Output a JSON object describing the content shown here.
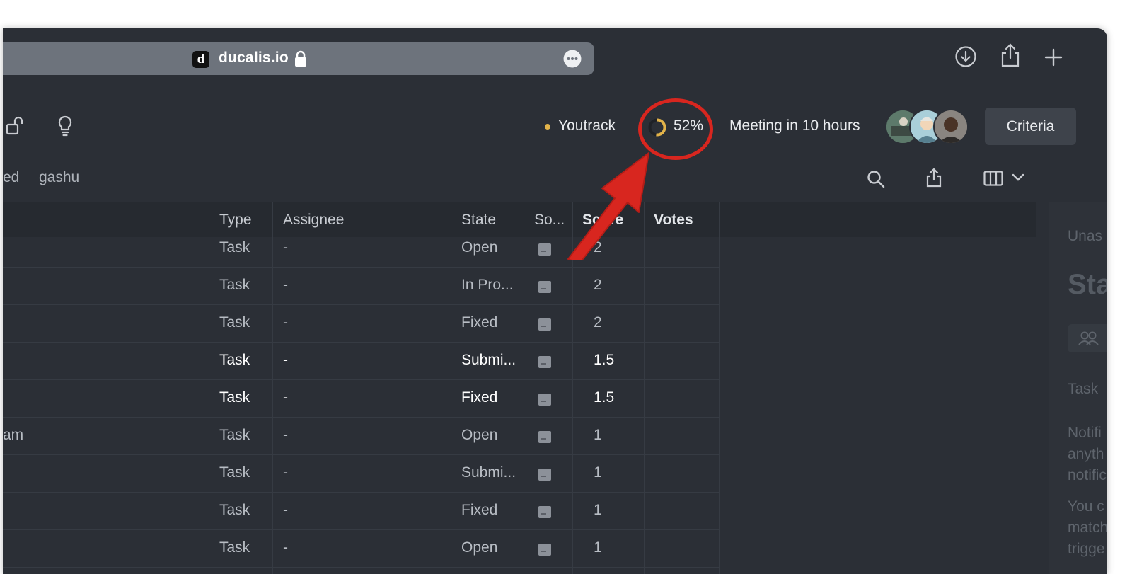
{
  "browser": {
    "favicon_letter": "d",
    "url": "ducalis.io"
  },
  "header": {
    "integration": "Youtrack",
    "progress_text": "52%",
    "progress_value": 0.52,
    "meeting": "Meeting in 10 hours",
    "criteria_label": "Criteria"
  },
  "tabs": [
    "ed",
    "gashu"
  ],
  "table": {
    "columns": [
      "Type",
      "Assignee",
      "State",
      "So...",
      "Score",
      "Votes"
    ],
    "rows": [
      {
        "prefix": "",
        "type": "Task",
        "assignee": "-",
        "state": "Open",
        "score": "2",
        "bright": false
      },
      {
        "prefix": "",
        "type": "Task",
        "assignee": "-",
        "state": "In Pro...",
        "score": "2",
        "bright": false
      },
      {
        "prefix": "",
        "type": "Task",
        "assignee": "-",
        "state": "Fixed",
        "score": "2",
        "bright": false
      },
      {
        "prefix": "",
        "type": "Task",
        "assignee": "-",
        "state": "Submi...",
        "score": "1.5",
        "bright": true
      },
      {
        "prefix": "",
        "type": "Task",
        "assignee": "-",
        "state": "Fixed",
        "score": "1.5",
        "bright": true
      },
      {
        "prefix": "am",
        "type": "Task",
        "assignee": "-",
        "state": "Open",
        "score": "1",
        "bright": false
      },
      {
        "prefix": "",
        "type": "Task",
        "assignee": "-",
        "state": "Submi...",
        "score": "1",
        "bright": false
      },
      {
        "prefix": "",
        "type": "Task",
        "assignee": "-",
        "state": "Fixed",
        "score": "1",
        "bright": false
      },
      {
        "prefix": "",
        "type": "Task",
        "assignee": "-",
        "state": "Open",
        "score": "1",
        "bright": false
      }
    ]
  },
  "side_panel": {
    "lines": [
      "Unas",
      "Sta",
      "Task",
      "Notifi",
      "anyth",
      "notific",
      "You c",
      "match",
      "trigge"
    ]
  },
  "colors": {
    "accent_yellow": "#e2b34a",
    "annotation_red": "#d8261f",
    "window_bg": "#2b2f36"
  }
}
